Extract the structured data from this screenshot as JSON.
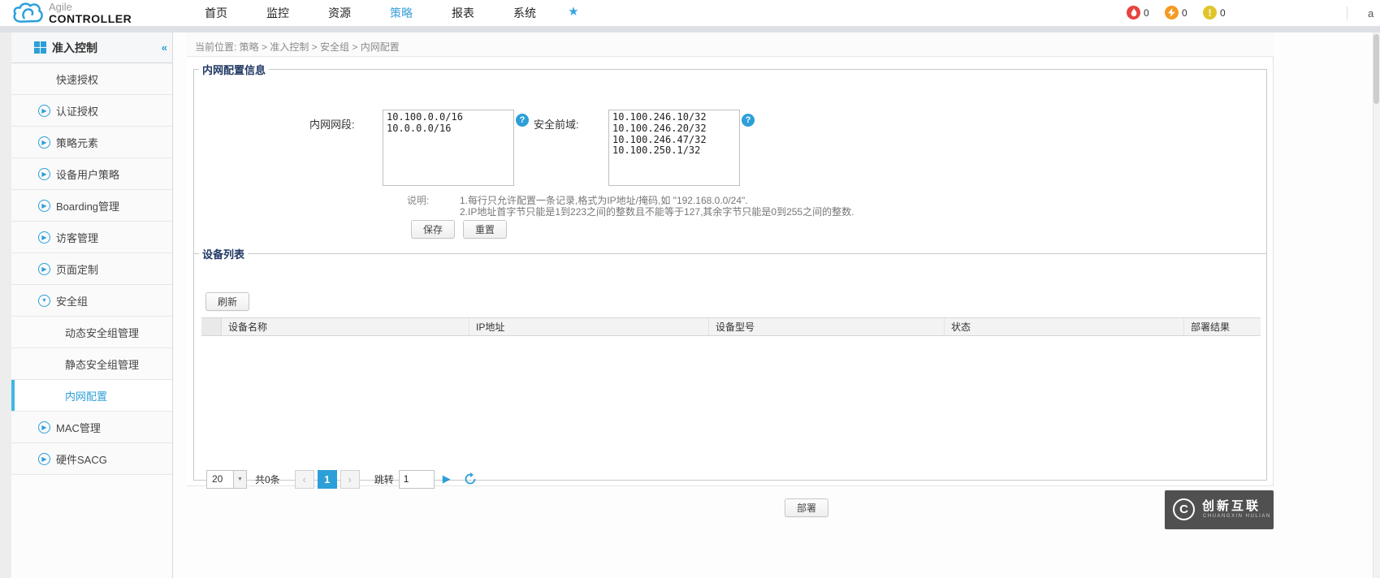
{
  "header": {
    "logo": {
      "line1": "Agile",
      "line2": "CONTROLLER"
    },
    "nav": [
      {
        "label": "首页"
      },
      {
        "label": "监控"
      },
      {
        "label": "资源"
      },
      {
        "label": "策略"
      },
      {
        "label": "报表"
      },
      {
        "label": "系统"
      }
    ],
    "favorite_icon": "star",
    "alarms": [
      {
        "name": "critical",
        "color": "#e64340",
        "count": "0"
      },
      {
        "name": "major",
        "color": "#f59a23",
        "count": "0"
      },
      {
        "name": "minor",
        "color": "#e0c52a",
        "count": "0"
      }
    ],
    "user": "a"
  },
  "sidebar": {
    "title": "准入控制",
    "items": [
      {
        "label": "快速授权"
      },
      {
        "label": "认证授权"
      },
      {
        "label": "策略元素"
      },
      {
        "label": "设备用户策略"
      },
      {
        "label": "Boarding管理"
      },
      {
        "label": "访客管理"
      },
      {
        "label": "页面定制"
      },
      {
        "label": "安全组"
      },
      {
        "label": "动态安全组管理"
      },
      {
        "label": "静态安全组管理"
      },
      {
        "label": "内网配置"
      },
      {
        "label": "MAC管理"
      },
      {
        "label": "硬件SACG"
      }
    ]
  },
  "breadcrumb": {
    "text": "当前位置: 策略 > 准入控制 > 安全组 > 内网配置"
  },
  "config": {
    "title": "内网配置信息",
    "intranet_label": "内网网段:",
    "intranet_value": "10.100.0.0/16\n10.0.0.0/16",
    "domain_label": "安全前域:",
    "domain_value": "10.100.246.10/32\n10.100.246.20/32\n10.100.246.47/32\n10.100.250.1/32",
    "note_label": "说明:",
    "note_line1": "1.每行只允许配置一条记录,格式为IP地址/掩码,如 \"192.168.0.0/24\".",
    "note_line2": "2.IP地址首字节只能是1到223之间的整数且不能等于127,其余字节只能是0到255之间的整数.",
    "save_button": "保存",
    "reset_button": "重置"
  },
  "devices": {
    "title": "设备列表",
    "refresh_button": "刷新",
    "columns": [
      {
        "label": "设备名称"
      },
      {
        "label": "IP地址"
      },
      {
        "label": "设备型号"
      },
      {
        "label": "状态"
      },
      {
        "label": "部署结果"
      }
    ],
    "rows": [],
    "pagination": {
      "page_size": "20",
      "total_text": "共0条",
      "current_page": "1",
      "jump_label": "跳转",
      "jump_value": "1"
    }
  },
  "footer": {
    "deploy_button": "部署"
  },
  "watermark": {
    "title": "创新互联",
    "subtitle": "CHUANGXIN HULIAN"
  },
  "colors": {
    "accent": "#2d9fd8",
    "legend_text": "#203864"
  }
}
